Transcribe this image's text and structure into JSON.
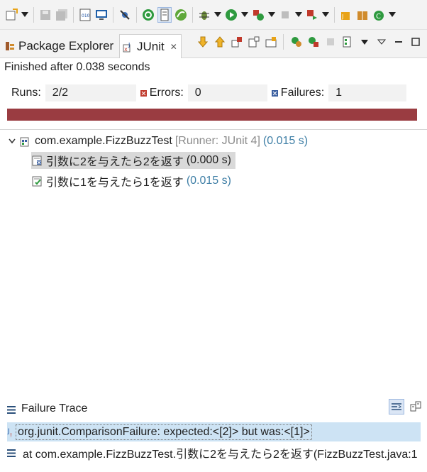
{
  "view": {
    "tabs": [
      {
        "label": "Package Explorer",
        "icon": "package-explorer-icon",
        "active": false
      },
      {
        "label": "JUnit",
        "icon": "junit-icon",
        "active": true
      }
    ],
    "close_glyph": "✕"
  },
  "junit": {
    "status": "Finished after 0.038 seconds",
    "runs_label": "Runs:",
    "runs_value": "2/2",
    "errors_label": "Errors:",
    "errors_value": "0",
    "failures_label": "Failures:",
    "failures_value": "1",
    "progress_color": "#9a3c41",
    "progress_fraction": 1.0
  },
  "tree": {
    "suite": {
      "name": "com.example.FizzBuzzTest",
      "runner": "[Runner: JUnit 4]",
      "time": "(0.015 s)"
    },
    "tests": [
      {
        "name": "引数に2を与えたら2を返す",
        "time": "(0.000 s)",
        "result": "failure",
        "selected": true
      },
      {
        "name": "引数に1を与えたら1を返す",
        "time": "(0.015 s)",
        "result": "pass",
        "selected": false
      }
    ]
  },
  "failure_trace": {
    "title": "Failure Trace",
    "lines": [
      "org.junit.ComparisonFailure: expected:<[2]> but was:<[1]>",
      "at com.example.FizzBuzzTest.引数に2を与えたら2を返す(FizzBuzzTest.java:1"
    ]
  },
  "colors": {
    "accent": "#3f7fa6",
    "failure": "#9a3c41",
    "selection": "#cde3f4"
  }
}
